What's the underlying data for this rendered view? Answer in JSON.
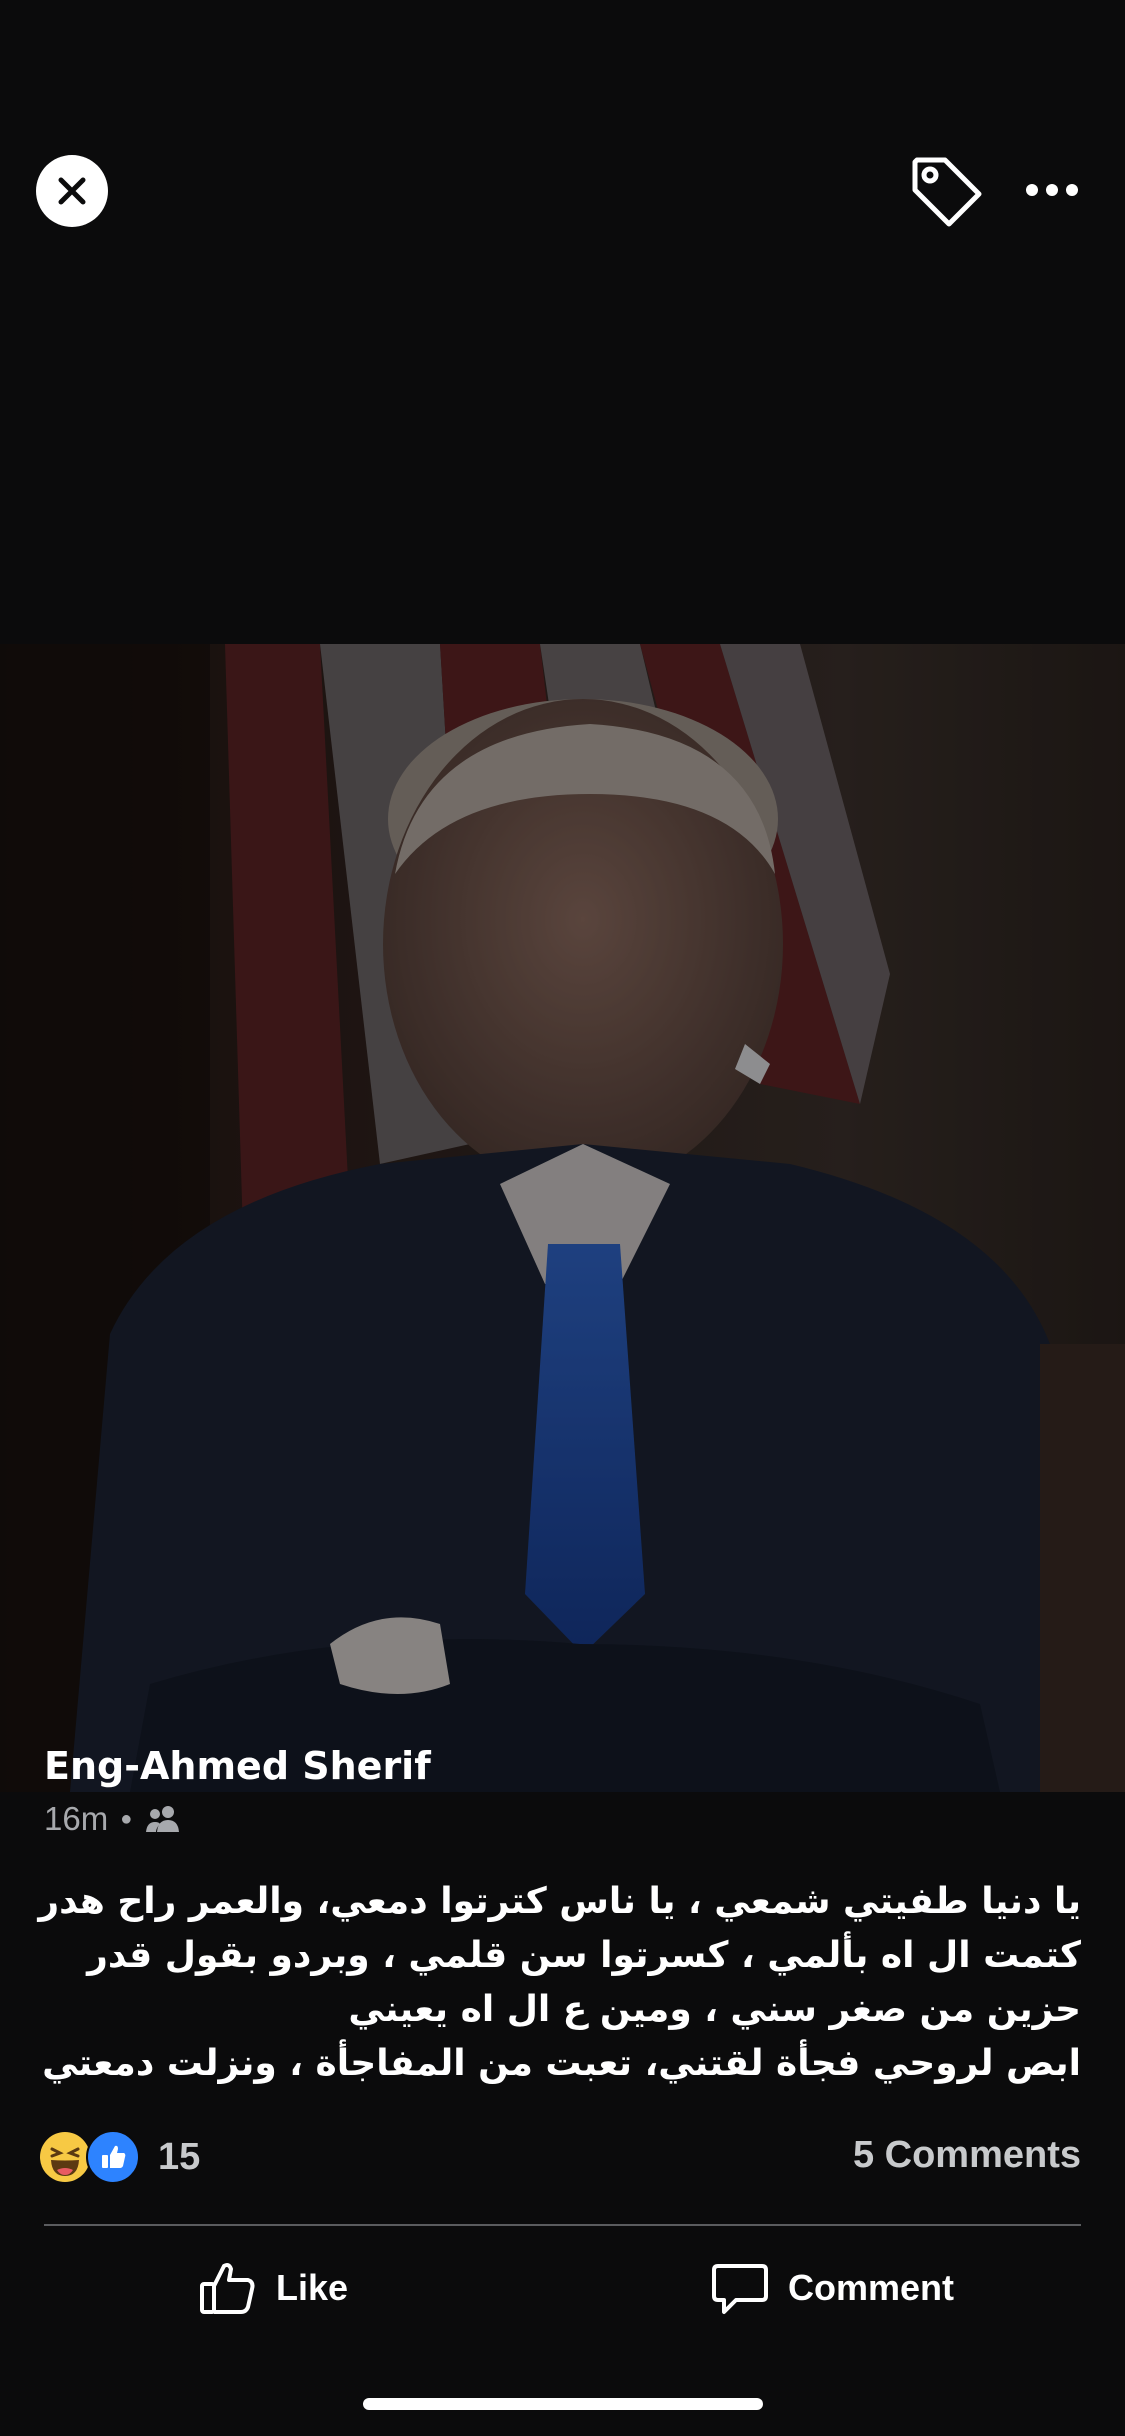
{
  "header": {
    "close_icon": "close-icon",
    "tag_icon": "tag-icon",
    "more_icon": "more-icon"
  },
  "post": {
    "author": "Eng-Ahmed Sherif",
    "time": "16m",
    "audience_icon": "friends-icon",
    "caption_lines": [
      "يا دنيا طفيتي شمعي ، يا ناس كترتوا دمعي، والعمر راح هدر",
      "كتمت ال اه بألمي ، كسرتوا سن قلمي ، وبردو بقول قدر",
      "حزين من صغر سني ، ومين ع ال اه يعيني",
      "ابص لروحي فجأة لقتني، تعبت من المفاجأة ، ونزلت دمعتي"
    ]
  },
  "stats": {
    "reactions": [
      "haha",
      "like"
    ],
    "reaction_count": "15",
    "comments": "5 Comments"
  },
  "actions": {
    "like_label": "Like",
    "comment_label": "Comment"
  },
  "colors": {
    "background": "#0b0b0c",
    "like_blue": "#2d83ff",
    "haha_yellow": "#f7c944"
  }
}
